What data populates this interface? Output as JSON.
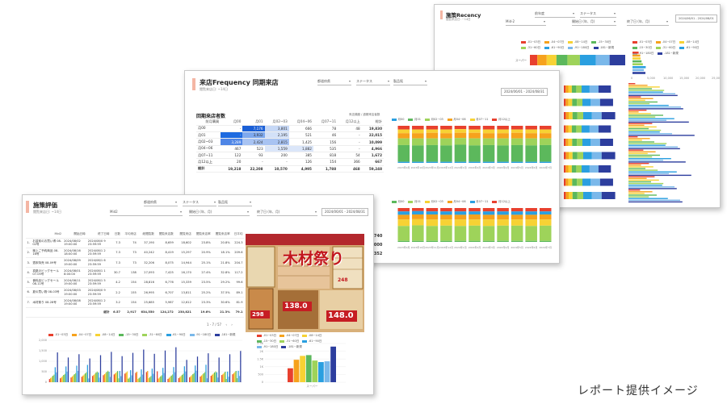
{
  "caption": "レポート提供イメージ",
  "colors": {
    "c1": "#e8402e",
    "c2": "#f6a21d",
    "c3": "#f7d234",
    "c4": "#5cb85c",
    "c5": "#9ed35a",
    "c6": "#2a9fe0",
    "c7": "#7ab8ea",
    "c8": "#2d3e9e",
    "accent": "#f4b6a4"
  },
  "recency": {
    "title": "施策Recency",
    "subtitle": "閲覧来店日: ~14日",
    "filter_vals": [
      "前年度",
      "Mid-2",
      "ステータス",
      "開始日 (年、月)",
      "終了日 (年、月)"
    ],
    "date_range": "2024/06/01 - 2024/08/01",
    "legend": [
      "-01~03日",
      "-04~07日",
      "-08~14日",
      "-15~30日",
      "-31~60日",
      "-61~90日",
      "-91~180日",
      "-181~新規"
    ],
    "bar_label": "スーパー",
    "axis": [
      "0",
      "5,000",
      "10,000",
      "15,000",
      "20,000",
      "25,000"
    ]
  },
  "frequency": {
    "title": "来店Frequency 同期来店",
    "subtitle": "閲覧来店日: ~14日",
    "filters": [
      "都道府県",
      "ステータス",
      "製品銘"
    ],
    "date_range": "2024/06/01 - 2024/08/31",
    "section_label": "回期来店者数",
    "right_tag": "来店頻度 / 過期来店者数",
    "table": {
      "headers": [
        "前月購買",
        "月00",
        "月01",
        "月02~03",
        "月04~06",
        "月07~11",
        "月12以上",
        "総計"
      ],
      "rows": [
        [
          "月00",
          "-",
          "7,176",
          "3,801",
          "666",
          "78",
          "48",
          "19,830"
        ],
        [
          "月01",
          "-",
          "3,932",
          "2,195",
          "521",
          "46",
          "-",
          "22,015"
        ],
        [
          "月02~03",
          "3,289",
          "2,424",
          "2,815",
          "1,425",
          "156",
          "-",
          "10,099"
        ],
        [
          "月04~06",
          "467",
          "523",
          "1,559",
          "1,882",
          "535",
          "-",
          "4,966"
        ],
        [
          "月07~11",
          "122",
          "93",
          "200",
          "385",
          "818",
          "54",
          "1,672"
        ],
        [
          "月12以上",
          "20",
          "-",
          "-",
          "126",
          "154",
          "366",
          "667"
        ]
      ],
      "total": [
        "総計",
        "19,218",
        "22,208",
        "10,570",
        "4,995",
        "1,788",
        "468",
        "59,248"
      ]
    },
    "legend": [
      "月00",
      "月01",
      "月02~03",
      "月04~06",
      "月07~11",
      "月12以上"
    ],
    "months": [
      "2023年9月",
      "2023年10月",
      "2023年11月",
      "2023年12月",
      "2024年1月",
      "2024年2月",
      "2024年3月",
      "2024年4月",
      "2024年5月",
      "2024年6月",
      "2024年7月"
    ],
    "peek_values": [
      ".740",
      ".000",
      ".352"
    ]
  },
  "evaluation": {
    "title": "施策評価",
    "subtitle": "閲覧来店日: ~14日",
    "filters": [
      "都道府県",
      "ステータス",
      "製品銘"
    ],
    "filter2": [
      "Mid2",
      "開始日 (年、月)",
      "終了日 (年、月)"
    ],
    "date_range": "2024/06/01 - 2024/08/31",
    "table": {
      "headers": [
        "Mid2",
        "開始日時",
        "終了日時",
        "日数",
        "平均来店",
        "総閲覧数",
        "閲覧来店数",
        "閲覧来店",
        "閲覧来店率",
        "閲覧来店率",
        "日平均"
      ],
      "rows": [
        [
          "1.",
          "お盆前のお買い得 08-02号",
          "2024/08/02 19:00:00",
          "2024/08/0 9 23:59:59",
          "7.3",
          "74",
          "37,190",
          "8,659",
          "18,602",
          "23.8%",
          "20.8%",
          "224.3"
        ],
        [
          "2.",
          "極上ご予約商品 08-16号",
          "2024/08/16 18:00:00",
          "2024/08/1 2 23:59:59",
          "7.3",
          "73",
          "40,242",
          "8,419",
          "15,297",
          "20.9%",
          "18.1%",
          "209.6"
        ],
        [
          "3.",
          "週末特売 08-09号",
          "2024/08/09 19:00:00",
          "2024/08/1 6 23:59:59",
          "7.3",
          "73",
          "32,206",
          "8,075",
          "14,944",
          "25.1%",
          "21.8%",
          "204.7"
        ],
        [
          "4.",
          "真夏のビッグセール 07-05号",
          "2024/08/01 8:00:00",
          "2024/08/1 1 23:59:59",
          "30.7",
          "138",
          "27,093",
          "7,425",
          "16,170",
          "27.4%",
          "32.8%",
          "117.2"
        ],
        [
          "5.",
          "食料品ビッグセール 08-11号",
          "2024/08/11 19:00:00",
          "2024/08/1 5 23:59:59",
          "4.2",
          "154",
          "28,816",
          "6,776",
          "15,339",
          "23.5%",
          "29.2%",
          "99.6"
        ],
        [
          "6.",
          "夏の買い物 08-03号",
          "2024/08/03 19:00:00",
          "2024/08/0 9 23:59:59",
          "2.2",
          "155",
          "26,995",
          "6,707",
          "13,811",
          "25.2%",
          "37.5%",
          "89.1"
        ],
        [
          "7.",
          "木材祭り 08-28号",
          "2024/08/08 19:00:00",
          "2024/08/1 2 23:59:59",
          "3.2",
          "154",
          "25,685",
          "5,987",
          "12,612",
          "23.3%",
          "30.6%",
          "81.9"
        ]
      ],
      "total": [
        "総計",
        "6.57",
        "2,917",
        "634,550",
        "124,272",
        "230,821",
        "19.6%",
        "21.3%",
        "79.1"
      ]
    },
    "pager": "1 - 7 / 57",
    "flyer_text": "木材祭り",
    "flyer_prices": [
      "148.0",
      "138.0",
      "298",
      "248"
    ],
    "legend": [
      "-01~03日",
      "-04~07日",
      "-08~14日",
      "-15~30日",
      "-31~60日",
      "-61~90日",
      "-91~180日",
      "-181~新規"
    ],
    "yaxis": [
      "2,000",
      "1,500",
      "1,000",
      "500",
      "0"
    ],
    "legend2": [
      "-01~03日",
      "-04~07日",
      "-08~14日",
      "-15~30日",
      "-31~60日",
      "-61~90日",
      "-91~180日",
      "-181~新規"
    ],
    "y2axis": [
      "2.5K",
      "2K",
      "1.5K",
      "1K",
      "500",
      "0"
    ],
    "x2label": "スーパー"
  },
  "chart_data": [
    {
      "type": "bar",
      "title": "施策Recency",
      "categories": [
        "スーパー"
      ],
      "series": [
        {
          "name": "-01~03日",
          "values": [
            1900
          ]
        },
        {
          "name": "-04~07日",
          "values": [
            2400
          ]
        },
        {
          "name": "-08~14日",
          "values": [
            2500
          ]
        },
        {
          "name": "-15~30日",
          "values": [
            2800
          ]
        },
        {
          "name": "-31~60日",
          "values": [
            3200
          ]
        },
        {
          "name": "-61~90日",
          "values": [
            4100
          ]
        },
        {
          "name": "-91~180日",
          "values": [
            3500
          ]
        },
        {
          "name": "-181~新規",
          "values": [
            4000
          ]
        }
      ],
      "xlim": [
        0,
        25000
      ]
    },
    {
      "type": "bar",
      "title": "来店Frequency 同期来店",
      "categories": [
        "2023年9月",
        "2023年10月",
        "2023年11月",
        "2023年12月",
        "2024年1月",
        "2024年2月",
        "2024年3月",
        "2024年4月",
        "2024年5月",
        "2024年6月",
        "2024年7月"
      ],
      "series": [
        {
          "name": "月00",
          "values": [
            3,
            3,
            3,
            3,
            3,
            3,
            3,
            3,
            3,
            3,
            3
          ]
        },
        {
          "name": "月01",
          "values": [
            45,
            44,
            45,
            44,
            46,
            44,
            45,
            44,
            45,
            44,
            45
          ]
        },
        {
          "name": "月02~03",
          "values": [
            18,
            19,
            18,
            19,
            18,
            19,
            18,
            19,
            18,
            19,
            18
          ]
        },
        {
          "name": "月04~06",
          "values": [
            14,
            14,
            15,
            14,
            14,
            15,
            14,
            14,
            15,
            14,
            14
          ]
        },
        {
          "name": "月07~11",
          "values": [
            10,
            10,
            9,
            10,
            10,
            9,
            10,
            10,
            9,
            10,
            10
          ]
        },
        {
          "name": "月12以上",
          "values": [
            10,
            10,
            10,
            10,
            9,
            10,
            10,
            10,
            10,
            10,
            10
          ]
        }
      ],
      "ylim": [
        0,
        100
      ]
    },
    {
      "type": "bar",
      "title": "施策評価",
      "ylim": [
        0,
        2000
      ],
      "groups": 18,
      "series_count": 8
    },
    {
      "type": "bar",
      "categories": [
        "スーパー"
      ],
      "series": [
        {
          "name": "-01~03日",
          "values": [
            900
          ]
        },
        {
          "name": "-04~07日",
          "values": [
            1450
          ]
        },
        {
          "name": "-08~14日",
          "values": [
            1700
          ]
        },
        {
          "name": "-15~30日",
          "values": [
            1750
          ]
        },
        {
          "name": "-31~60日",
          "values": [
            1400
          ]
        },
        {
          "name": "-61~90日",
          "values": [
            1300
          ]
        },
        {
          "name": "-91~180日",
          "values": [
            1350
          ]
        },
        {
          "name": "-181~新規",
          "values": [
            2300
          ]
        }
      ],
      "ylim": [
        0,
        2500
      ]
    }
  ]
}
